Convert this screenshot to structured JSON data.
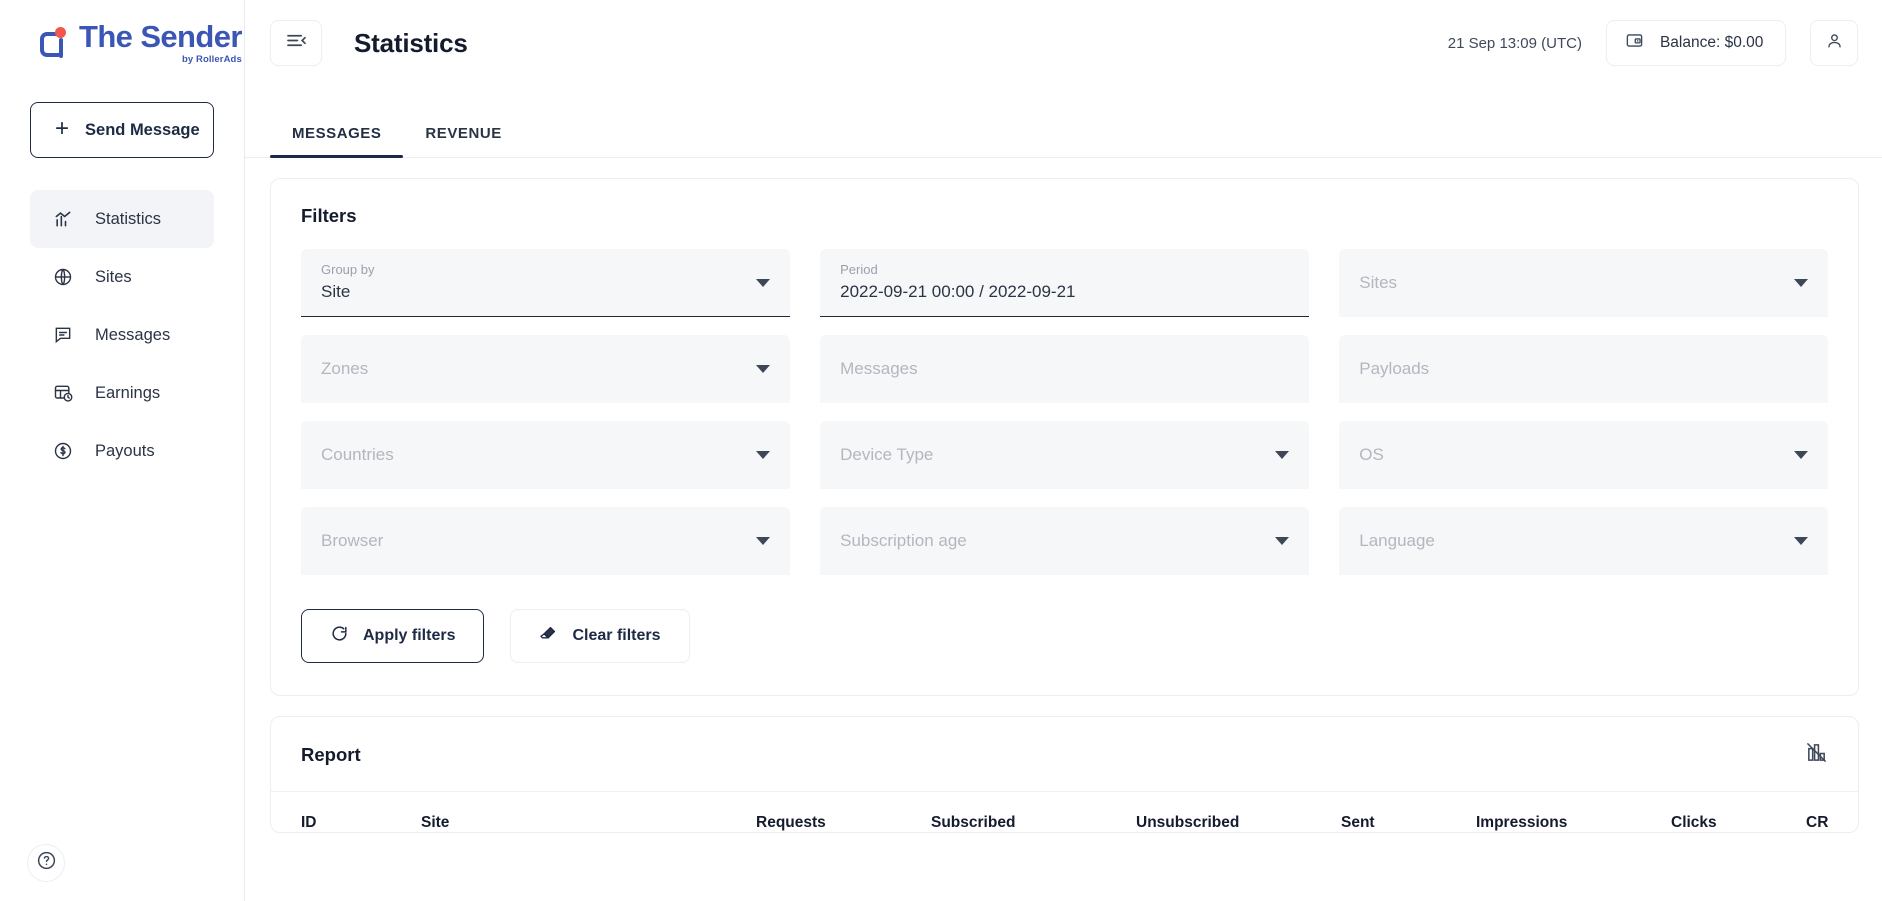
{
  "brand": {
    "name": "The Sender",
    "tagline": "by RollerAds",
    "color": "#3b56b5",
    "accent_dot_color": "#f2564c"
  },
  "sidebar": {
    "send_message_button": "Send Message",
    "items": [
      {
        "label": "Statistics",
        "icon": "statistics-icon",
        "active": true
      },
      {
        "label": "Sites",
        "icon": "globe-icon",
        "active": false
      },
      {
        "label": "Messages",
        "icon": "message-icon",
        "active": false
      },
      {
        "label": "Earnings",
        "icon": "earnings-icon",
        "active": false
      },
      {
        "label": "Payouts",
        "icon": "dollar-coin-icon",
        "active": false
      }
    ],
    "help_icon": "question-mark-icon"
  },
  "topbar": {
    "menu_icon": "hamburger-collapse-icon",
    "title": "Statistics",
    "clock": "21 Sep 13:09 (UTC)",
    "balance_label": "Balance: $0.00",
    "balance_icon": "wallet-icon",
    "account_icon": "user-icon"
  },
  "tabs": [
    {
      "label": "MESSAGES",
      "active": true
    },
    {
      "label": "REVENUE",
      "active": false
    }
  ],
  "filters": {
    "title": "Filters",
    "fields": [
      {
        "label": "Group by",
        "value": "Site",
        "placeholder": "",
        "filled": true,
        "dropdown": true
      },
      {
        "label": "Period",
        "value": "2022-09-21 00:00 / 2022-09-21",
        "placeholder": "",
        "filled": true,
        "dropdown": false
      },
      {
        "label": "",
        "value": "",
        "placeholder": "Sites",
        "filled": false,
        "dropdown": true
      },
      {
        "label": "",
        "value": "",
        "placeholder": "Zones",
        "filled": false,
        "dropdown": true
      },
      {
        "label": "",
        "value": "",
        "placeholder": "Messages",
        "filled": false,
        "dropdown": false
      },
      {
        "label": "",
        "value": "",
        "placeholder": "Payloads",
        "filled": false,
        "dropdown": false
      },
      {
        "label": "",
        "value": "",
        "placeholder": "Countries",
        "filled": false,
        "dropdown": true
      },
      {
        "label": "",
        "value": "",
        "placeholder": "Device Type",
        "filled": false,
        "dropdown": true
      },
      {
        "label": "",
        "value": "",
        "placeholder": "OS",
        "filled": false,
        "dropdown": true
      },
      {
        "label": "",
        "value": "",
        "placeholder": "Browser",
        "filled": false,
        "dropdown": true
      },
      {
        "label": "",
        "value": "",
        "placeholder": "Subscription age",
        "filled": false,
        "dropdown": true
      },
      {
        "label": "",
        "value": "",
        "placeholder": "Language",
        "filled": false,
        "dropdown": true
      }
    ],
    "apply_button": "Apply filters",
    "apply_icon": "refresh-icon",
    "clear_button": "Clear filters",
    "clear_icon": "eraser-icon"
  },
  "report": {
    "title": "Report",
    "toggle_icon": "chart-off-icon",
    "columns": [
      "ID",
      "Site",
      "Requests",
      "Subscribed",
      "Unsubscribed",
      "Sent",
      "Impressions",
      "Clicks",
      "CR"
    ]
  }
}
